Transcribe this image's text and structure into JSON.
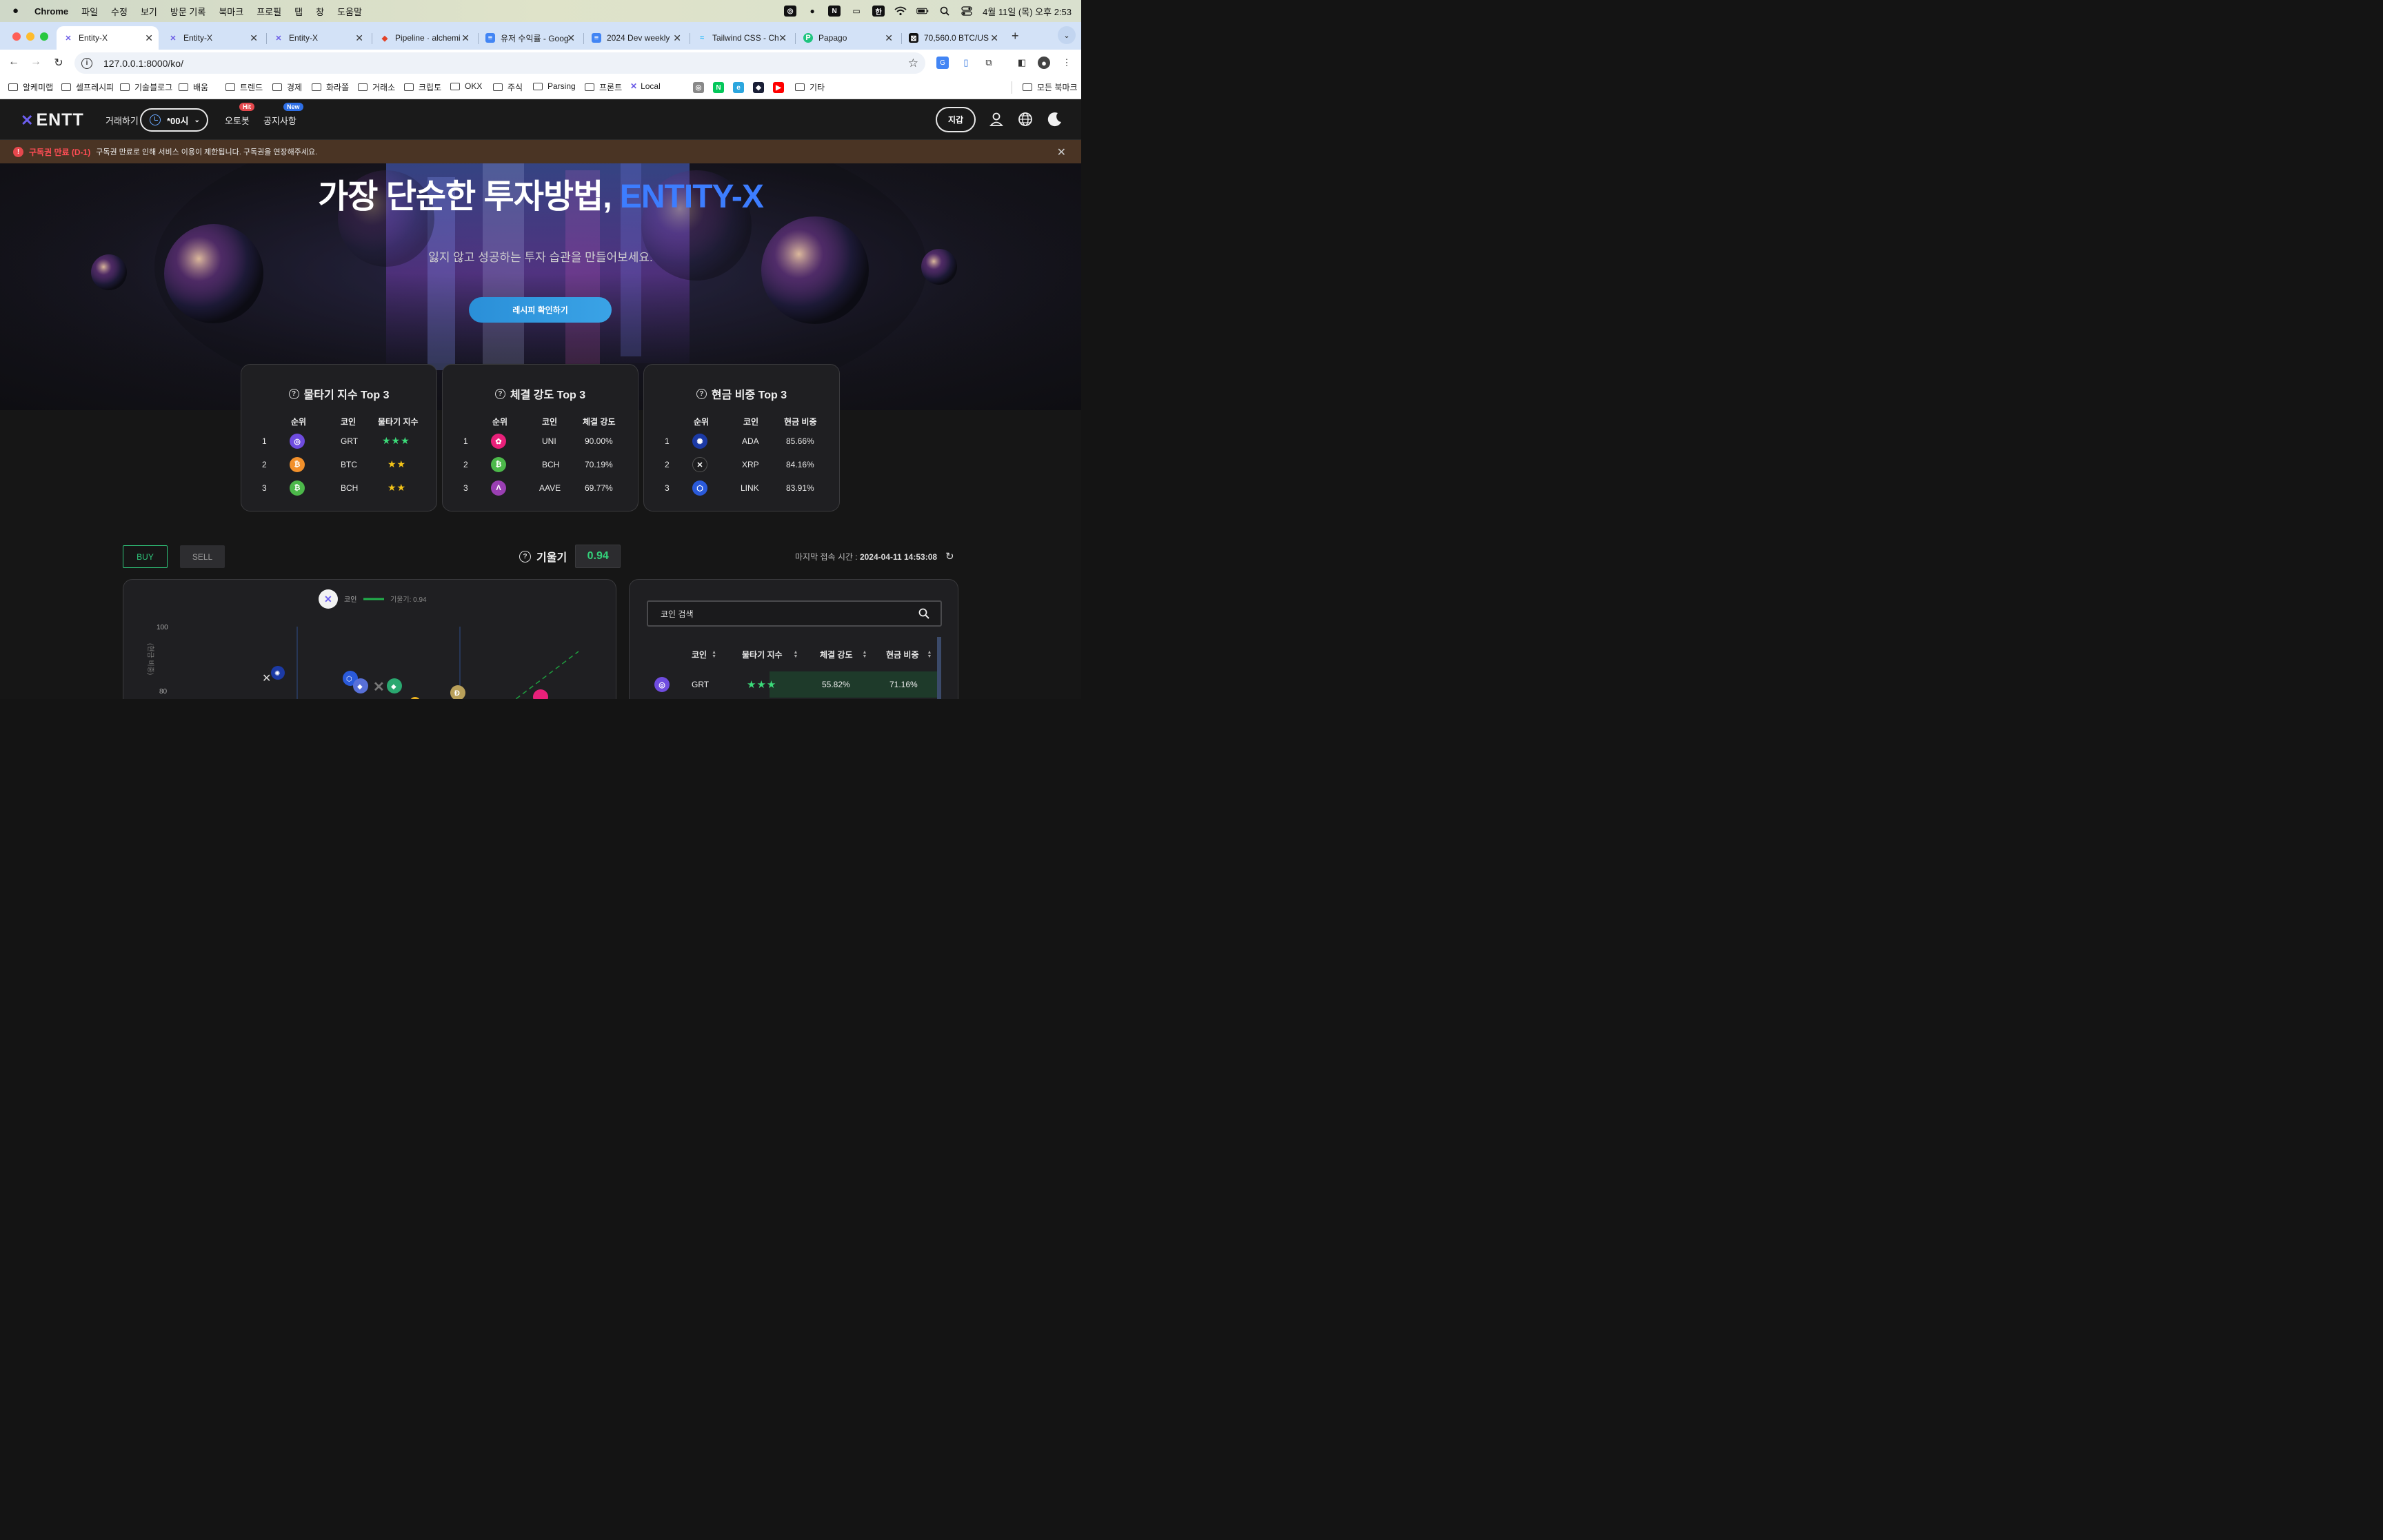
{
  "menubar": {
    "app_name": "Chrome",
    "items": [
      "파일",
      "수정",
      "보기",
      "방문 기록",
      "북마크",
      "프로필",
      "탭",
      "창",
      "도움말"
    ],
    "input_source": "한",
    "datetime": "4월 11일 (목) 오후 2:53"
  },
  "tabs": [
    {
      "title": "Entity-X",
      "active": true
    },
    {
      "title": "Entity-X",
      "active": false
    },
    {
      "title": "Entity-X",
      "active": false
    },
    {
      "title": "Pipeline · alchemi",
      "active": false
    },
    {
      "title": "유저 수익률 - Goog",
      "active": false
    },
    {
      "title": "2024 Dev weekly",
      "active": false
    },
    {
      "title": "Tailwind CSS - Ch",
      "active": false
    },
    {
      "title": "Papago",
      "active": false
    },
    {
      "title": "70,560.0 BTC/US",
      "active": false
    }
  ],
  "address": {
    "url": "127.0.0.1:8000/ko/"
  },
  "bookmarks": [
    {
      "label": "알케미랩"
    },
    {
      "label": "셀프레시피"
    },
    {
      "label": "기술블로그"
    },
    {
      "label": "배움"
    },
    {
      "label": "트렌드"
    },
    {
      "label": "경제"
    },
    {
      "label": "화라쫄"
    },
    {
      "label": "거래소"
    },
    {
      "label": "크립토"
    },
    {
      "label": "OKX"
    },
    {
      "label": "주식"
    },
    {
      "label": "Parsing"
    },
    {
      "label": "프론트"
    },
    {
      "label": "Local"
    },
    {
      "label": "기타"
    },
    {
      "label": "모든 북마크"
    }
  ],
  "site": {
    "logo_text": "ENTT",
    "nav": {
      "trade": "거래하기",
      "time_select": "*00시",
      "autobot": "오토봇",
      "autobot_badge": "Hit",
      "notice": "공지사항",
      "notice_badge": "New"
    },
    "wallet_button": "지갑",
    "alert": {
      "title": "구독권 만료 (D-1)",
      "message": "구독권 만료로 인해 서비스 이용이 제한됩니다. 구독권을 연장해주세요."
    },
    "hero": {
      "title_main": "가장 단순한 투자방법, ",
      "title_accent": "ENTITY-X",
      "subtitle": "잃지 않고 성공하는 투자 습관을 만들어보세요.",
      "cta": "레시피 확인하기"
    },
    "cards": [
      {
        "title": "물타기 지수 Top 3",
        "headers": [
          "순위",
          "코인",
          "물타기 지수"
        ],
        "rows": [
          {
            "rank": "1",
            "coin": "GRT",
            "value": "★★★",
            "icon": "grt-icon",
            "color": "#6f4cdf"
          },
          {
            "rank": "2",
            "coin": "BTC",
            "value": "★★",
            "icon": "btc-icon",
            "color": "#f2902b"
          },
          {
            "rank": "3",
            "coin": "BCH",
            "value": "★★",
            "icon": "bch-icon",
            "color": "#4cb84a"
          }
        ]
      },
      {
        "title": "체결 강도 Top 3",
        "headers": [
          "순위",
          "코인",
          "체결 강도"
        ],
        "rows": [
          {
            "rank": "1",
            "coin": "UNI",
            "value": "90.00%",
            "icon": "uni-icon",
            "color": "#e8207a"
          },
          {
            "rank": "2",
            "coin": "BCH",
            "value": "70.19%",
            "icon": "bch-icon",
            "color": "#4cb84a"
          },
          {
            "rank": "3",
            "coin": "AAVE",
            "value": "69.77%",
            "icon": "aave-icon",
            "color": "#9a3fb3"
          }
        ]
      },
      {
        "title": "현금 비중 Top 3",
        "headers": [
          "순위",
          "코인",
          "현금 비중"
        ],
        "rows": [
          {
            "rank": "1",
            "coin": "ADA",
            "value": "85.66%",
            "icon": "ada-icon",
            "color": "#1c3aa5"
          },
          {
            "rank": "2",
            "coin": "XRP",
            "value": "84.16%",
            "icon": "xrp-icon",
            "color": "#1d1d1f"
          },
          {
            "rank": "3",
            "coin": "LINK",
            "value": "83.91%",
            "icon": "link-icon",
            "color": "#2a5ada"
          }
        ]
      }
    ],
    "trade": {
      "buy": "BUY",
      "sell": "SELL",
      "slope_label": "기울기",
      "slope_value": "0.94",
      "last_access_label": "마지막 접속 시간 : ",
      "last_access_value": "2024-04-11 14:53:08"
    },
    "chart": {
      "legend_coin": "코인",
      "legend_slope": "기울기: 0.94",
      "y_label": "(현금 비중)",
      "y_ticks": [
        "100",
        "80"
      ]
    },
    "coin_list": {
      "search_placeholder": "코인 검색",
      "headers": [
        "코인",
        "물타기 지수",
        "체결 강도",
        "현금 비중"
      ],
      "rows": [
        {
          "coin": "GRT",
          "water": "★★★",
          "strength": "55.82%",
          "cash": "71.16%"
        }
      ]
    }
  }
}
